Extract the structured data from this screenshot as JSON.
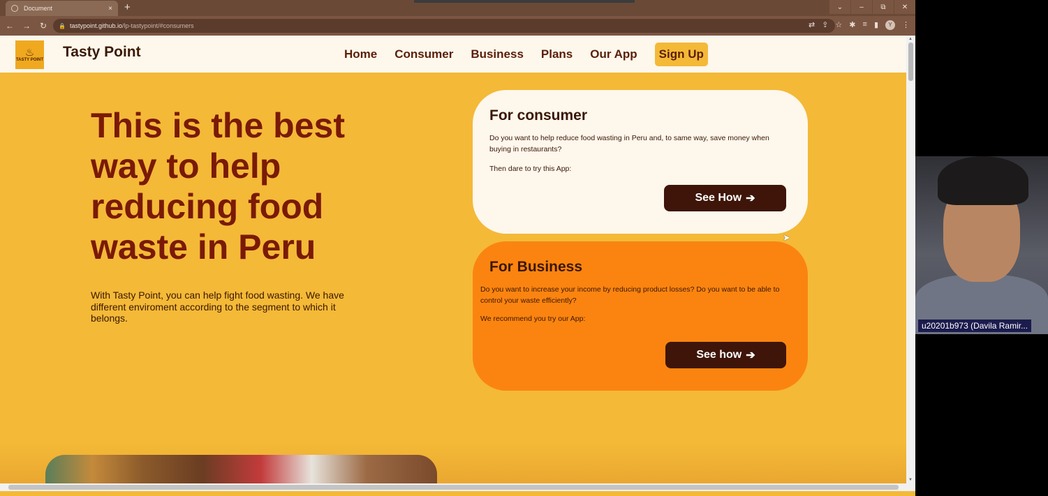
{
  "browser": {
    "tab_title": "Document",
    "tab_close": "×",
    "new_tab": "+",
    "url_host": "tastypoint.github.io",
    "url_path": "/lp-tastypoint/#consumers",
    "window_controls": [
      "⌄",
      "–",
      "⧉",
      "✕"
    ],
    "profile_initial": "Y"
  },
  "site": {
    "brand": "Tasty Point",
    "logo_text": "TASTY POINT",
    "nav": [
      {
        "label": "Home"
      },
      {
        "label": "Consumer"
      },
      {
        "label": "Business"
      },
      {
        "label": "Plans"
      },
      {
        "label": "Our App"
      },
      {
        "label": "Sign Up"
      }
    ]
  },
  "hero": {
    "title": "This is the best way to help reducing food waste in Peru",
    "subtitle": "With Tasty Point, you can help fight food wasting. We have different enviroment according to the segment to which it belongs."
  },
  "consumer_card": {
    "heading": "For consumer",
    "question": "Do you want to help reduce food wasting in Peru and, to same way, save money when buying in restaurants?",
    "cta_text": "Then dare to try this App:",
    "button_label": "See How",
    "button_arrow": "➔"
  },
  "business_card": {
    "heading": "For Business",
    "question": "Do you want to increase your income by reducing product losses? Do you want to be able to control your waste efficiently?",
    "cta_text": "We recommend you try our App:",
    "button_label": "See how",
    "button_arrow": "➔"
  },
  "video": {
    "participant_label": "u20201b973 (Davila Ramir..."
  },
  "colors": {
    "page_bg": "#f4b937",
    "header_bg": "#fdf7ec",
    "title_color": "#7a1a07",
    "business_card": "#fb8410",
    "button_bg": "#3e1508"
  }
}
